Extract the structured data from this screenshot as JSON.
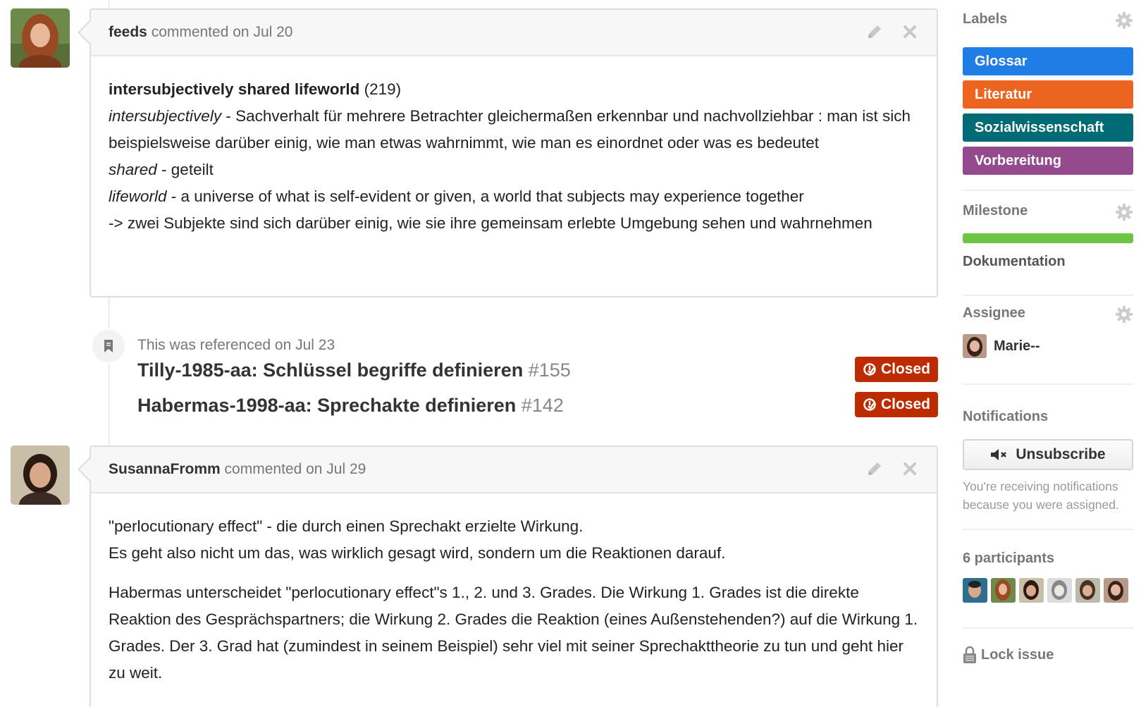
{
  "comments": [
    {
      "author": "feeds",
      "meta": "commented on Jul 20",
      "body": {
        "term": "intersubjectively shared lifeworld",
        "term_page": "(219)",
        "lines": [
          {
            "em": "intersubjectively",
            "text": " - Sachverhalt für mehrere Betrachter gleichermaßen erkennbar und nachvollziehbar : man ist sich beispielsweise darüber einig, wie man etwas wahrnimmt, wie man es einordnet oder was es bedeutet"
          },
          {
            "em": "shared",
            "text": " - geteilt"
          },
          {
            "em": "lifeworld",
            "text": " - a universe of what is self-evident or given, a world that subjects may experience together"
          }
        ],
        "conclusion": "-> zwei Subjekte sind sich darüber einig, wie sie ihre gemeinsam erlebte Umgebung sehen und wahrnehmen"
      }
    },
    {
      "author": "SusannaFromm",
      "meta": "commented on Jul 29",
      "body": {
        "para1_line1": "\"perlocutionary effect\" - die durch einen Sprechakt erzielte Wirkung.",
        "para1_line2": "Es geht also nicht um das, was wirklich gesagt wird, sondern um die Reaktionen darauf.",
        "para2": "Habermas unterscheidet \"perlocutionary effect\"s 1., 2. und 3. Grades. Die Wirkung 1. Grades ist die direkte Reaktion des Gesprächspartners; die Wirkung 2. Grades die Reaktion (eines Außenstehenden?) auf die Wirkung 1. Grades. Der 3. Grad hat (zumindest in seinem Beispiel) sehr viel mit seiner Sprechakttheorie zu tun und geht hier zu weit."
      }
    }
  ],
  "reference": {
    "text": "This was referenced on Jul 23",
    "items": [
      {
        "title": "Tilly-1985-aa: Schlüssel begriffe definieren",
        "number": "#155",
        "status": "Closed"
      },
      {
        "title": "Habermas-1998-aa: Sprechakte definieren",
        "number": "#142",
        "status": "Closed"
      }
    ]
  },
  "sidebar": {
    "labels": {
      "title": "Labels",
      "items": [
        {
          "name": "Glossar",
          "color": "#207de5"
        },
        {
          "name": "Literatur",
          "color": "#eb6420"
        },
        {
          "name": "Sozialwissenschaft",
          "color": "#006b75"
        },
        {
          "name": "Vorbereitung",
          "color": "#944a8c"
        }
      ]
    },
    "milestone": {
      "title": "Milestone",
      "name": "Dokumentation",
      "progress": 1.0
    },
    "assignee": {
      "title": "Assignee",
      "name": "Marie--"
    },
    "notifications": {
      "title": "Notifications",
      "button": "Unsubscribe",
      "reason": "You're receiving notifications because you were assigned."
    },
    "participants": {
      "title": "6 participants",
      "count": 6
    },
    "lock": "Lock issue"
  },
  "colors": {
    "closed": "#bd2c00",
    "progress": "#6cc644"
  }
}
